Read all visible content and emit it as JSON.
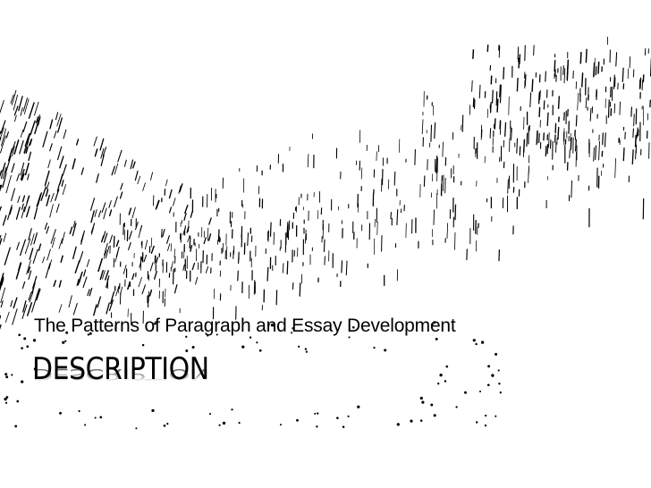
{
  "slide": {
    "subtitle": "The Patterns of Paragraph and Essay Development",
    "title": "DESCRIPTION"
  },
  "colors": {
    "background": "#ffffff",
    "text": "#000000",
    "wave_pattern": "#000000"
  }
}
